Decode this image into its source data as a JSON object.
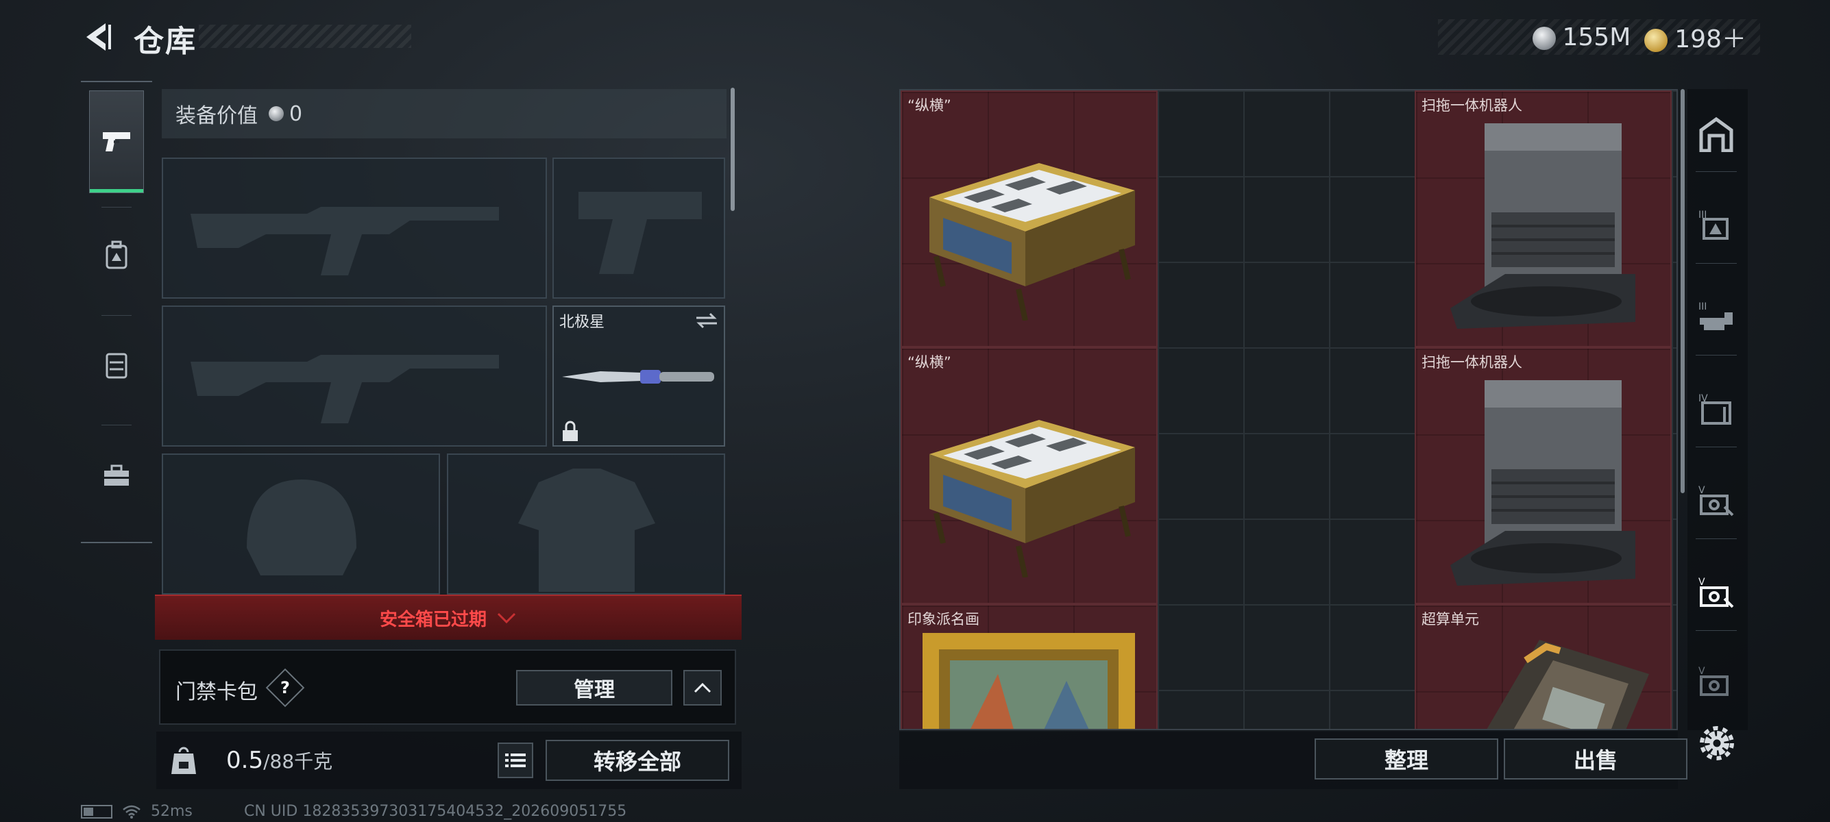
{
  "header": {
    "title": "仓库",
    "currency": [
      {
        "icon": "silver-coin-icon",
        "value": "155M"
      },
      {
        "icon": "gold-coin-icon",
        "value": "198＋"
      }
    ]
  },
  "tabs": [
    {
      "name": "pistol-icon",
      "active": true
    },
    {
      "name": "backpack-icon",
      "active": false
    },
    {
      "name": "chest-rig-icon",
      "active": false
    },
    {
      "name": "toolbox-icon",
      "active": false
    }
  ],
  "equipment": {
    "value_label": "装备价值",
    "value": "0",
    "melee_name": "北极星",
    "safebox_status": "安全箱已过期",
    "keycard_label": "门禁卡包",
    "keycard_help": "?",
    "manage_label": "管理",
    "weight_current": "0.5",
    "weight_max": "/88千克",
    "transfer_all_label": "转移全部"
  },
  "stash": {
    "items": [
      {
        "name": "“纵横”",
        "type": "chess-set"
      },
      {
        "name": "扫拖一体机器人",
        "type": "robot-vacuum"
      },
      {
        "name": "“纵横”",
        "type": "chess-set"
      },
      {
        "name": "扫拖一体机器人",
        "type": "robot-vacuum"
      },
      {
        "name": "印象派名画",
        "type": "painting"
      },
      {
        "name": "超算单元",
        "type": "compute-unit"
      }
    ],
    "sort_label": "整理",
    "sell_label": "出售"
  },
  "right_rail": [
    {
      "name": "storage-home-icon"
    },
    {
      "name": "storage-tier-3a-icon",
      "label": "III"
    },
    {
      "name": "storage-tier-3b-icon",
      "label": "III"
    },
    {
      "name": "storage-tier-4-icon",
      "label": "IV"
    },
    {
      "name": "storage-tier-5a-icon",
      "label": "V"
    },
    {
      "name": "storage-tier-5b-icon",
      "label": "V"
    },
    {
      "name": "storage-tier-5c-icon",
      "label": "V"
    }
  ],
  "status": {
    "ping": "52ms",
    "uid": "CN UID 182835397303175404532_202609051755"
  },
  "colors": {
    "accent_green": "#3ed18a",
    "warning_red": "#ff4a4a",
    "item_rarity_red": "#4a2026"
  }
}
